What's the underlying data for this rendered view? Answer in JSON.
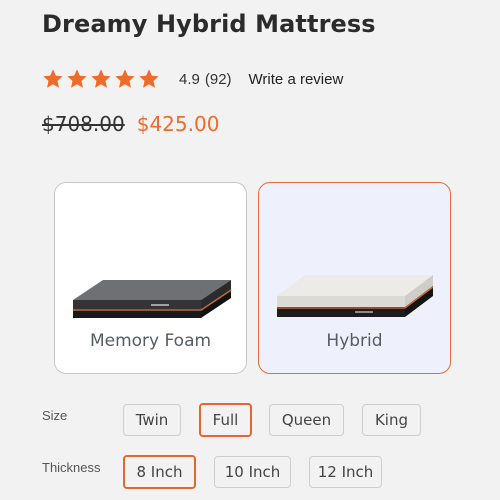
{
  "product": {
    "title": "Dreamy Hybrid Mattress",
    "rating": {
      "value": "4.9",
      "count": "(92)",
      "stars": 5,
      "write_review": "Write a review"
    },
    "price": {
      "original": "$708.00",
      "sale": "$425.00"
    }
  },
  "colors": {
    "accent": "#ee6b2a",
    "star": "#ee6b2a",
    "selected_card_bg": "#eef0fb"
  },
  "types": [
    {
      "label": "Memory Foam",
      "selected": false,
      "image": "gray-mattress-image"
    },
    {
      "label": "Hybrid",
      "selected": true,
      "image": "white-mattress-image"
    }
  ],
  "size": {
    "label": "Size",
    "options": [
      "Twin",
      "Full",
      "Queen",
      "King"
    ],
    "selected": "Full"
  },
  "thickness": {
    "label": "Thickness",
    "options": [
      "8 Inch",
      "10 Inch",
      "12 Inch"
    ],
    "selected": "8 Inch"
  }
}
